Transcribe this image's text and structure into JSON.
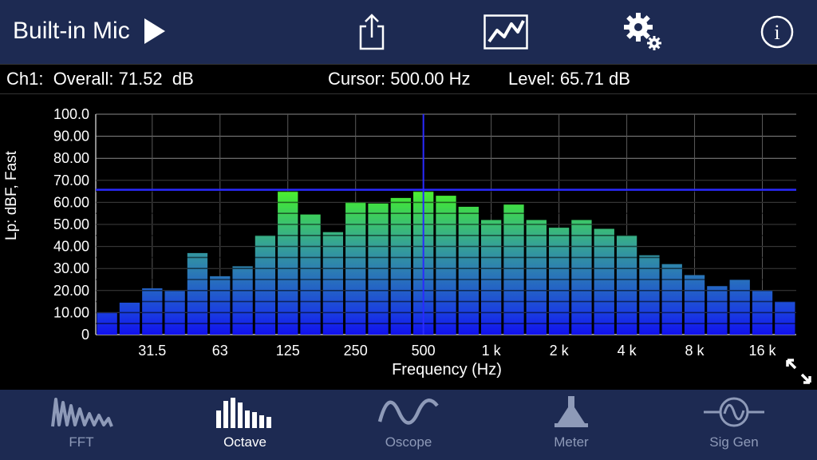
{
  "topbar": {
    "source_label": "Built-in Mic",
    "icons": [
      "play-icon",
      "share-icon",
      "chart-icon",
      "settings-icon",
      "info-icon"
    ],
    "info_glyph": "i"
  },
  "status": {
    "overall": "Ch1:  Overall: 71.52  dB",
    "cursor": "Cursor: 500.00 Hz",
    "level": "Level: 65.71 dB"
  },
  "chart_data": {
    "type": "bar",
    "ylabel": "Lp: dBF, Fast",
    "xlabel": "Frequency (Hz)",
    "ylim": [
      0,
      100
    ],
    "yticks": [
      "100.0",
      "90.00",
      "80.00",
      "70.00",
      "60.00",
      "50.00",
      "40.00",
      "30.00",
      "20.00",
      "10.00",
      "0"
    ],
    "xtick_labels": [
      {
        "label": "31.5",
        "band": 2
      },
      {
        "label": "63",
        "band": 5
      },
      {
        "label": "125",
        "band": 8
      },
      {
        "label": "250",
        "band": 11
      },
      {
        "label": "500",
        "band": 14
      },
      {
        "label": "1 k",
        "band": 17
      },
      {
        "label": "2 k",
        "band": 20
      },
      {
        "label": "4 k",
        "band": 23
      },
      {
        "label": "8 k",
        "band": 26
      },
      {
        "label": "16 k",
        "band": 29
      }
    ],
    "values": [
      10,
      14.5,
      21,
      20,
      37,
      26.5,
      31,
      45,
      65,
      54.5,
      46.5,
      60,
      59.5,
      62,
      65,
      63,
      58,
      52,
      59,
      52,
      48.5,
      52,
      48,
      45,
      36,
      32,
      27,
      22,
      25,
      20,
      15
    ],
    "cursor_band": 14,
    "level_line": 65.71,
    "grid": true
  },
  "tabs": [
    {
      "label": "FFT",
      "icon": "fft-icon",
      "active": false
    },
    {
      "label": "Octave",
      "icon": "octave-icon",
      "active": true
    },
    {
      "label": "Oscope",
      "icon": "oscope-icon",
      "active": false
    },
    {
      "label": "Meter",
      "icon": "meter-icon",
      "active": false
    },
    {
      "label": "Sig Gen",
      "icon": "sig-gen-icon",
      "active": false
    }
  ],
  "colors": {
    "bar_bands": [
      "#1111ee",
      "#1a3ee0",
      "#2360c8",
      "#2d80b0",
      "#35a098",
      "#3bc070",
      "#40e040",
      "#5cff20"
    ],
    "header_bg": "#1d2a52",
    "cursor_line": "#2a2aff",
    "tab_inactive": "#8e9ab8"
  }
}
